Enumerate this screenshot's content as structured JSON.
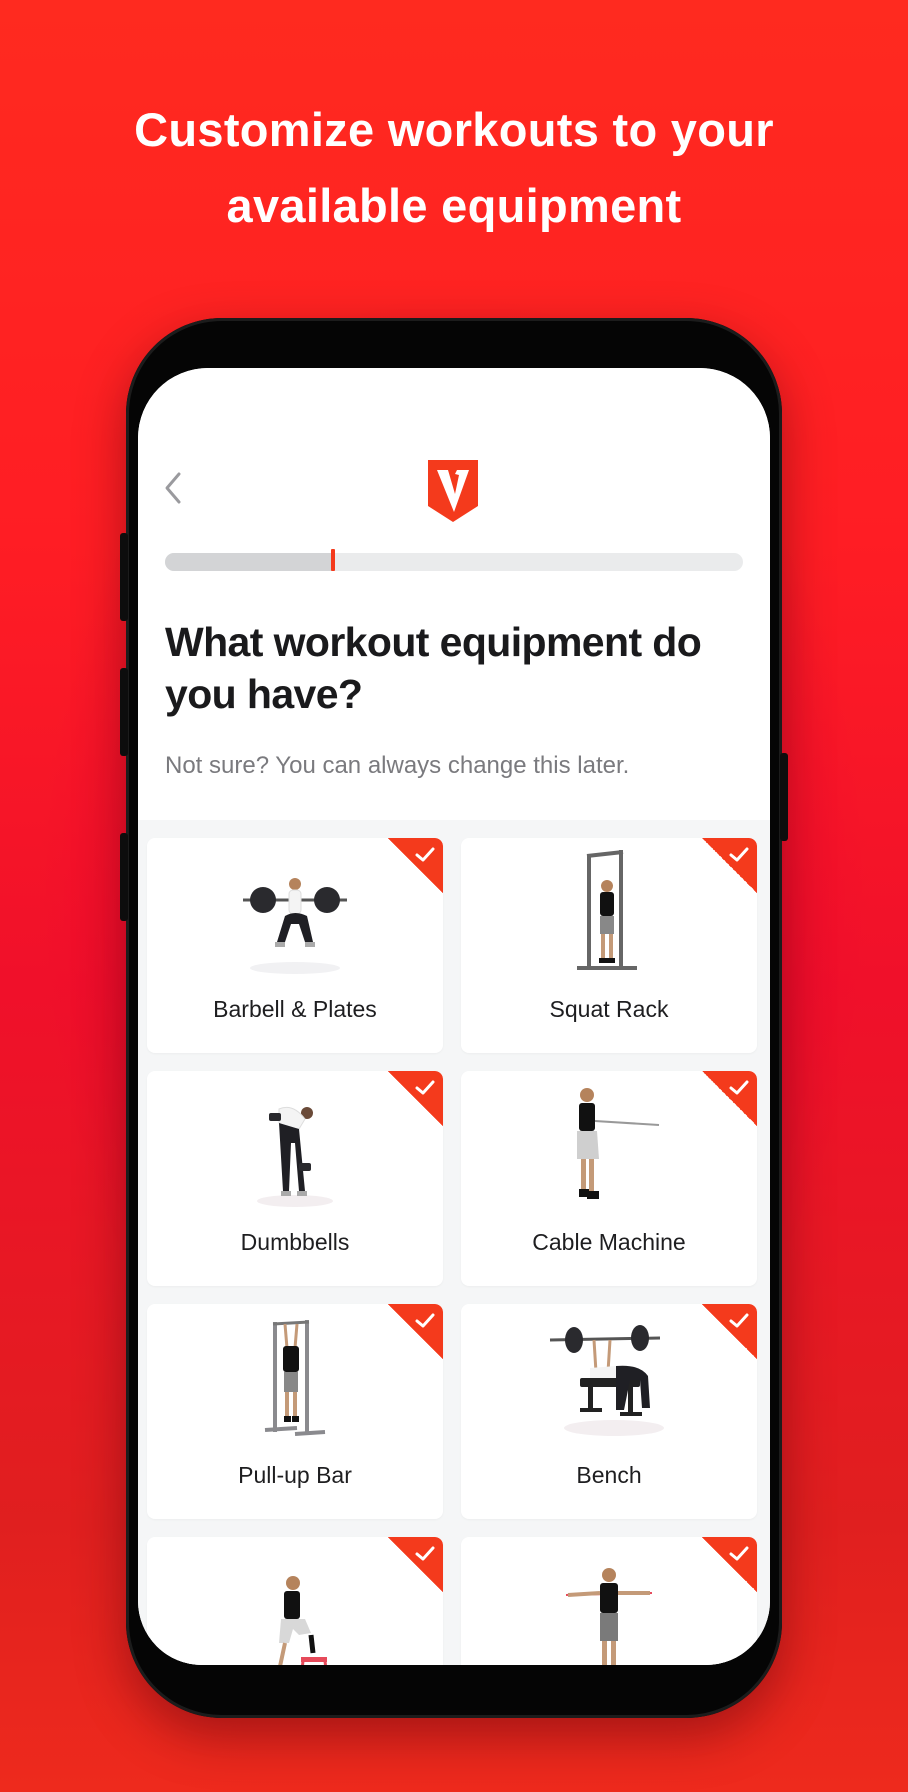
{
  "promo": {
    "headline_line1": "Customize workouts to your",
    "headline_line2": "available equipment"
  },
  "colors": {
    "brand": "#f43a1c",
    "background": "#ff1d24",
    "title_text": "#1a1a1c",
    "subtitle_text": "#7a7a7e"
  },
  "app": {
    "back_icon": "chevron-left-icon",
    "logo_letter": "V",
    "progress_fraction": 0.29,
    "title": "What workout equipment do you have?",
    "subtitle": "Not sure? You can always change this later."
  },
  "equipment": [
    {
      "label": "Barbell & Plates",
      "selected": true,
      "icon": "barbell-squat-image"
    },
    {
      "label": "Squat Rack",
      "selected": true,
      "icon": "squat-rack-image"
    },
    {
      "label": "Dumbbells",
      "selected": true,
      "icon": "dumbbell-row-image"
    },
    {
      "label": "Cable Machine",
      "selected": true,
      "icon": "cable-row-image"
    },
    {
      "label": "Pull-up Bar",
      "selected": true,
      "icon": "pull-up-bar-image"
    },
    {
      "label": "Bench",
      "selected": true,
      "icon": "bench-press-image"
    },
    {
      "label": "",
      "selected": true,
      "icon": "step-up-box-image"
    },
    {
      "label": "",
      "selected": true,
      "icon": "resistance-band-image"
    }
  ]
}
